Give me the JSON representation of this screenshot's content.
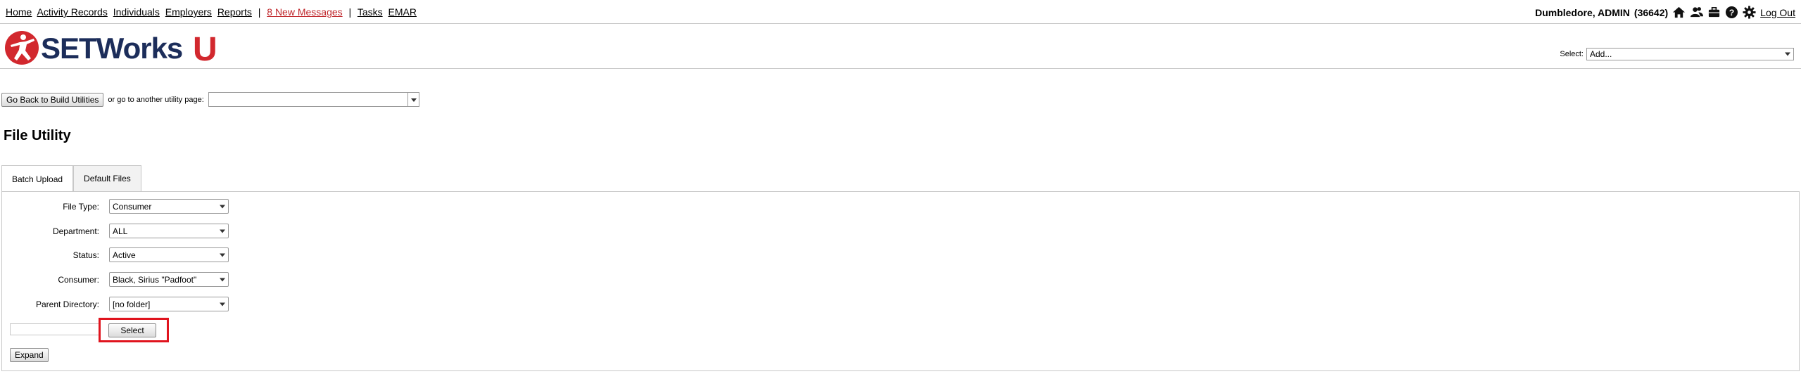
{
  "topbar": {
    "nav": [
      {
        "label": "Home"
      },
      {
        "label": "Activity Records"
      },
      {
        "label": "Individuals"
      },
      {
        "label": "Employers"
      },
      {
        "label": "Reports"
      }
    ],
    "separator": "|",
    "messages_link": "8 New Messages",
    "nav2": [
      {
        "label": "Tasks"
      },
      {
        "label": "EMAR"
      }
    ],
    "user_name": "Dumbledore, ADMIN",
    "user_id": "(36642)",
    "logout": "Log Out",
    "icons": [
      "home-icon",
      "users-icon",
      "briefcase-icon",
      "help-icon",
      "gear-icon"
    ],
    "message_color": "#c0282d"
  },
  "header": {
    "logo_text": "SETWorks",
    "logo_letter": "U",
    "select_label": "Select:",
    "select_value": "Add..."
  },
  "utility": {
    "back_button": "Go Back to Build Utilities",
    "goto_label": "or go to another utility page:",
    "goto_value": ""
  },
  "page_title": "File Utility",
  "tabs": [
    {
      "label": "Batch Upload",
      "active": true
    },
    {
      "label": "Default Files",
      "active": false
    }
  ],
  "form": {
    "fields": [
      {
        "label": "File Type:",
        "value": "Consumer"
      },
      {
        "label": "Department:",
        "value": "ALL"
      },
      {
        "label": "Status:",
        "value": "Active"
      },
      {
        "label": "Consumer:",
        "value": "Black, Sirius \"Padfoot\""
      },
      {
        "label": "Parent Directory:",
        "value": "[no folder]"
      }
    ],
    "file_value": "",
    "select_button": "Select",
    "expand_button": "Expand"
  },
  "colors": {
    "brand_red": "#c0282d",
    "highlight": "#e0141e",
    "logo_navy": "#1c2d5a"
  }
}
